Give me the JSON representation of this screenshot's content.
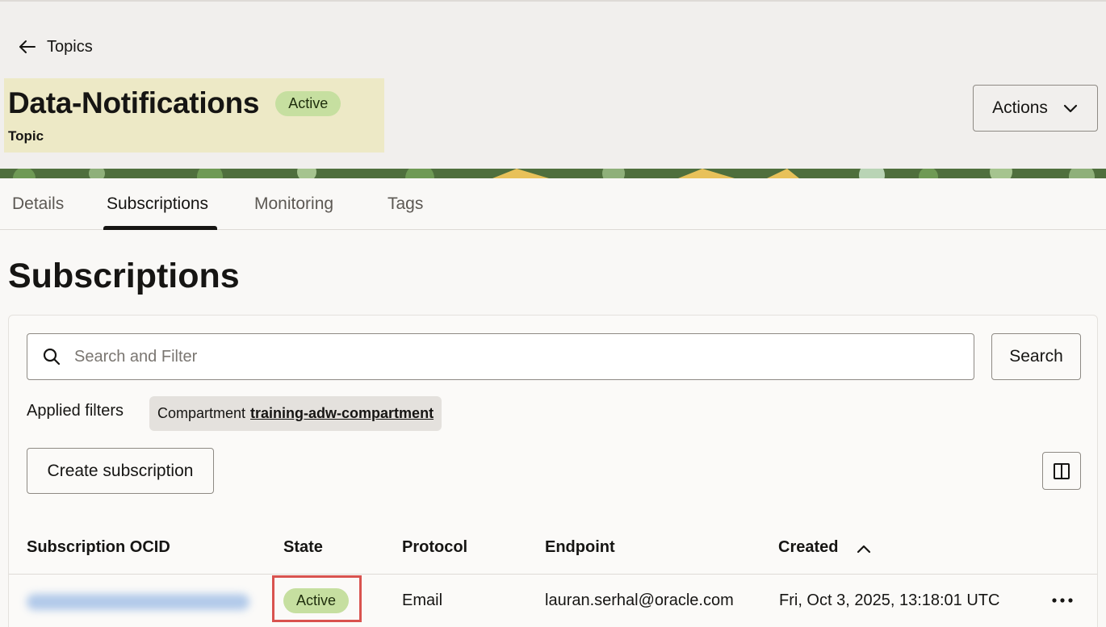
{
  "breadcrumb": {
    "back_label": "Topics",
    "back_icon": "arrow-left-icon"
  },
  "header": {
    "title": "Data-Notifications",
    "status": "Active",
    "subtitle": "Topic",
    "actions_label": "Actions"
  },
  "tabs": [
    {
      "label": "Details",
      "active": false
    },
    {
      "label": "Subscriptions",
      "active": true
    },
    {
      "label": "Monitoring",
      "active": false
    },
    {
      "label": "Tags",
      "active": false
    }
  ],
  "section": {
    "title": "Subscriptions"
  },
  "search": {
    "placeholder": "Search and Filter",
    "button_label": "Search"
  },
  "filters": {
    "label": "Applied filters",
    "chip_key": "Compartment",
    "chip_value": "training-adw-compartment"
  },
  "toolbar": {
    "create_label": "Create subscription",
    "columns_icon": "columns-icon"
  },
  "table": {
    "headers": [
      "Subscription OCID",
      "State",
      "Protocol",
      "Endpoint",
      "Created"
    ],
    "sort_column": "Created",
    "sort_direction": "ascending",
    "rows": [
      {
        "ocid": "",
        "state": "Active",
        "protocol": "Email",
        "endpoint": "lauran.serhal@oracle.com",
        "created": "Fri, Oct 3, 2025, 13:18:01 UTC"
      }
    ]
  },
  "colors": {
    "badge_bg": "#c6dfa0",
    "highlight_border": "#d9534f",
    "title_highlight": "#ede9c6"
  }
}
